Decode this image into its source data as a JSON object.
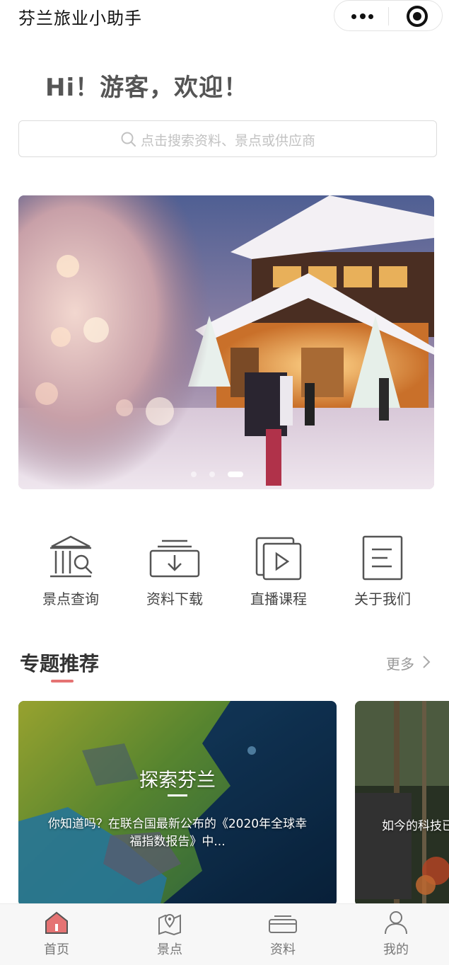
{
  "app": {
    "title": "芬兰旅业小助手"
  },
  "capsule": {
    "more_icon": "more-dots-icon",
    "close_icon": "target-icon"
  },
  "greeting": "Hi！游客，欢迎！",
  "search": {
    "placeholder": "点击搜索资料、景点或供应商",
    "icon": "search-icon"
  },
  "banner": {
    "slide_count": 3,
    "active_index": 2
  },
  "quick_links": [
    {
      "label": "景点查询",
      "icon": "museum-search-icon"
    },
    {
      "label": "资料下载",
      "icon": "download-tray-icon"
    },
    {
      "label": "直播课程",
      "icon": "play-video-icon"
    },
    {
      "label": "关于我们",
      "icon": "document-icon"
    }
  ],
  "section": {
    "title": "专题推荐",
    "more_label": "更多"
  },
  "cards": [
    {
      "title": "探索芬兰",
      "desc": "你知道吗？在联合国最新公布的《2020年全球幸福指数报告》中..."
    },
    {
      "desc": "如今的科技已"
    }
  ],
  "tabs": [
    {
      "label": "首页",
      "icon": "home-icon",
      "active": true
    },
    {
      "label": "景点",
      "icon": "map-pin-icon",
      "active": false
    },
    {
      "label": "资料",
      "icon": "folder-icon",
      "active": false
    },
    {
      "label": "我的",
      "icon": "user-icon",
      "active": false
    }
  ],
  "colors": {
    "accent": "#e57373",
    "tab_active_icon": "#e57373"
  }
}
